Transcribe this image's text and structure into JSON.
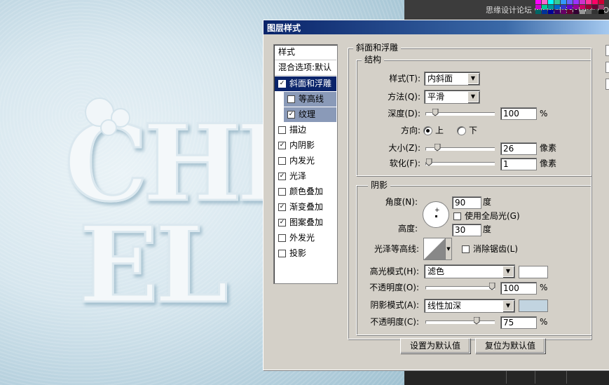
{
  "canvas": {
    "text_line1": "CHE",
    "text_line2": "EL"
  },
  "watermark": "思缘设计论坛 www.MISSYUAN.COM",
  "colors": {
    "canvas_light": "#eaf3f7",
    "canvas_dark": "#9fc1d1",
    "title_start": "#0a246a",
    "title_end": "#a6caf0",
    "highlight_swatch": "#ffffff",
    "shadow_swatch": "#c2d4e0"
  },
  "dialog": {
    "title": "图层样式",
    "styles_header": "样式",
    "blend_options": "混合选项:默认",
    "items": [
      {
        "label": "斜面和浮雕",
        "checked": true
      },
      {
        "label": "等高线",
        "checked": false
      },
      {
        "label": "纹理",
        "checked": true
      },
      {
        "label": "描边",
        "checked": false
      },
      {
        "label": "内阴影",
        "checked": true
      },
      {
        "label": "内发光",
        "checked": false
      },
      {
        "label": "光泽",
        "checked": true
      },
      {
        "label": "颜色叠加",
        "checked": false
      },
      {
        "label": "渐变叠加",
        "checked": true
      },
      {
        "label": "图案叠加",
        "checked": true
      },
      {
        "label": "外发光",
        "checked": false
      },
      {
        "label": "投影",
        "checked": false
      }
    ],
    "check_mark": "✓",
    "bevel": {
      "title": "斜面和浮雕",
      "structure_title": "结构",
      "style_label": "样式(T):",
      "style_value": "内斜面",
      "technique_label": "方法(Q):",
      "technique_value": "平滑",
      "depth_label": "深度(D):",
      "depth_value": "100",
      "depth_unit": "%",
      "depth_fraction": 0.1,
      "direction_label": "方向:",
      "direction_up": "上",
      "direction_down": "下",
      "direction_selected": "上",
      "size_label": "大小(Z):",
      "size_value": "26",
      "size_unit": "像素",
      "size_fraction": 0.13,
      "soften_label": "软化(F):",
      "soften_value": "1",
      "soften_unit": "像素",
      "soften_fraction": 0.0
    },
    "shading": {
      "title": "阴影",
      "angle_label": "角度(N):",
      "angle_value": "90",
      "angle_unit": "度",
      "global_light_label": "使用全局光(G)",
      "global_light_checked": false,
      "altitude_label": "高度:",
      "altitude_value": "30",
      "altitude_unit": "度",
      "gloss_label": "光泽等高线:",
      "antialias_label": "消除锯齿(L)",
      "antialias_checked": false,
      "highlight_mode_label": "高光模式(H):",
      "highlight_mode_value": "滤色",
      "highlight_opacity_label": "不透明度(O):",
      "highlight_opacity_value": "100",
      "highlight_opacity_unit": "%",
      "highlight_opacity_fraction": 1.0,
      "shadow_mode_label": "阴影模式(A):",
      "shadow_mode_value": "线性加深",
      "shadow_opacity_label": "不透明度(C):",
      "shadow_opacity_value": "75",
      "shadow_opacity_unit": "%",
      "shadow_opacity_fraction": 0.75
    },
    "buttons": {
      "set_default": "设置为默认值",
      "reset_default": "复位为默认值"
    }
  }
}
